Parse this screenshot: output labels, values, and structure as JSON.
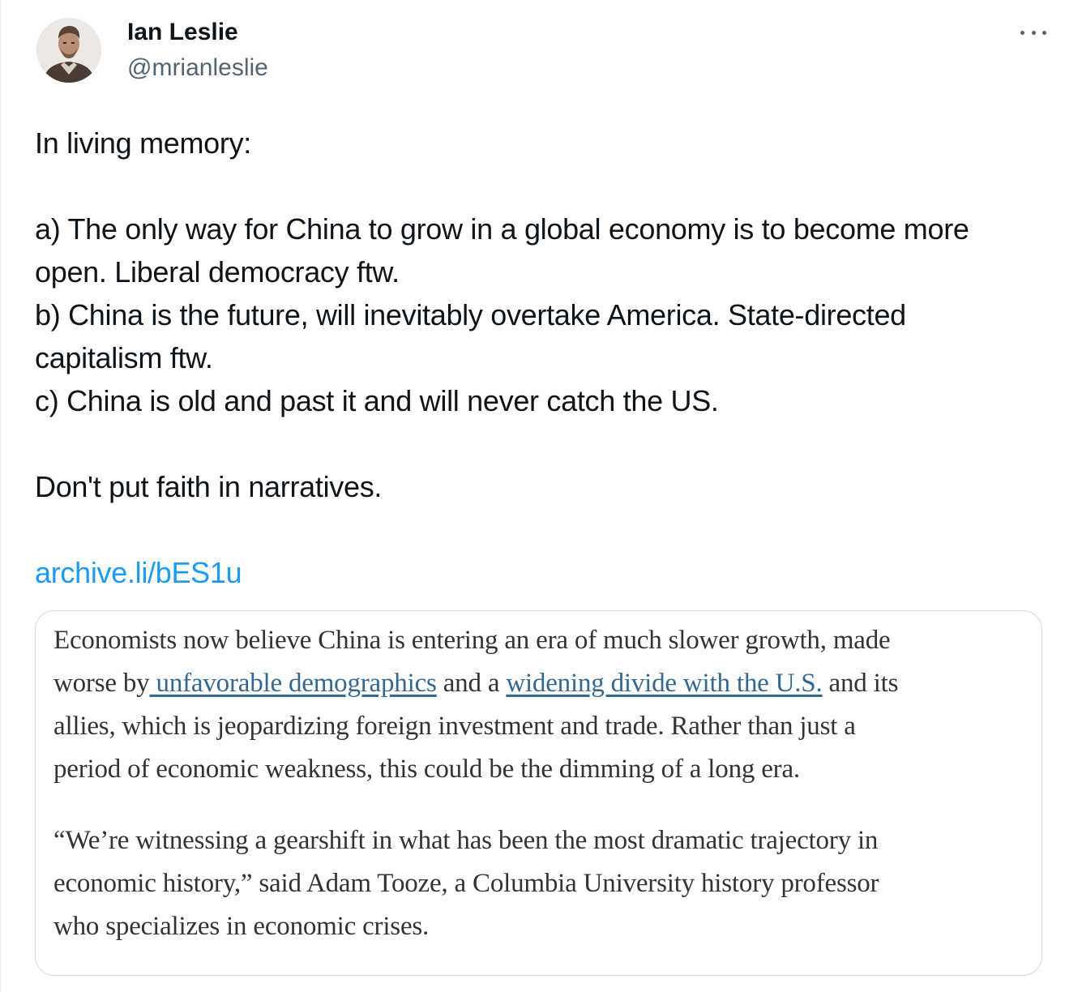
{
  "tweet": {
    "author": {
      "name": "Ian Leslie",
      "handle": "@mrianleslie",
      "avatar_icon": "avatar-photo-icon"
    },
    "more_icon": "more-options-icon",
    "text_lines": [
      "In living memory:",
      "",
      "a) The only way for China to grow in a global economy is to become more",
      "open. Liberal democracy ftw.",
      "b) China is the future, will inevitably overtake America. State-directed",
      "capitalism ftw.",
      "c) China is old and past it and will never catch  the US.",
      "",
      "Don't put faith in narratives.",
      ""
    ],
    "link": "archive.li/bES1u",
    "link_color": "#1d9bf0"
  },
  "quote_image": {
    "paragraph1": {
      "line1": "Economists now believe China is entering an era of much slower growth, made",
      "line2_a": "worse by",
      "line2_link1": " unfavorable demographics",
      "line2_b": " and a ",
      "line2_link2": "widening divide with the U.S.",
      "line2_c": " and its",
      "line3": "allies, which is jeopardizing foreign investment and trade. Rather than just a",
      "line4": "period of economic weakness, this could be the dimming of a long era."
    },
    "paragraph2": {
      "line1": "“We’re witnessing a gearshift in what has been the most dramatic trajectory in",
      "line2": "economic history,” said Adam Tooze, a Columbia University history professor",
      "line3": "who specializes in economic crises."
    },
    "link_color": "#326891"
  }
}
